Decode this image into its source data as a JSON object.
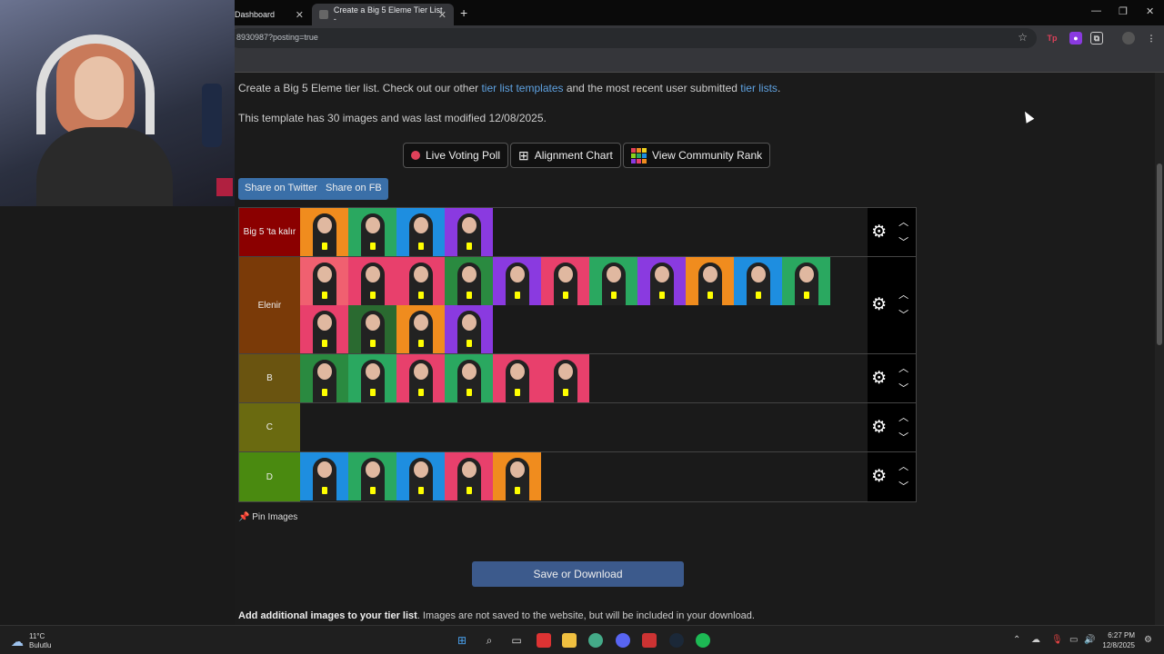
{
  "browser": {
    "tabs": [
      {
        "label": "Dashboard"
      },
      {
        "label": "Create a Big 5 Eleme Tier List -"
      }
    ],
    "url": "8930987?posting=true",
    "ext_tp": "Tp"
  },
  "page": {
    "intro_prefix": "Create a Big 5 Eleme tier list. Check out our other ",
    "intro_link1": "tier list templates",
    "intro_mid": " and the most recent user submitted ",
    "intro_link2": "tier lists",
    "intro_suffix": ".",
    "info": "This template has 30 images and was last modified 12/08/2025.",
    "buttons": {
      "live_voting": "Live Voting Poll",
      "alignment": "Alignment Chart",
      "community": "View Community Rank"
    },
    "share": {
      "twitter": "Share on Twitter",
      "fb": "Share on FB"
    },
    "tiers": [
      {
        "label": "Big 5 'ta kalır",
        "color": "#8b0000",
        "images": [
          "#f08c1e",
          "#2aa860",
          "#1e8ee0",
          "#8a3ae0"
        ]
      },
      {
        "label": "Elenir",
        "color": "#7a3a08",
        "images": [
          "#f06070",
          "#e8406c",
          "#e8406c",
          "#2a8a40",
          "#8a3ae0",
          "#e8406c",
          "#2aa860",
          "#8a3ae0",
          "#f08c1e",
          "#1e8ee0",
          "#2aa860",
          "#e8406c",
          "#2a6a30",
          "#f08c1e",
          "#8a3ae0"
        ]
      },
      {
        "label": "B",
        "color": "#6a5410",
        "images": [
          "#2a8a40",
          "#2aa860",
          "#e8406c",
          "#2aa860",
          "#e8406c",
          "#e8406c"
        ]
      },
      {
        "label": "C",
        "color": "#6a6a10",
        "images": []
      },
      {
        "label": "D",
        "color": "#4a8a10",
        "images": [
          "#1e8ee0",
          "#2aa860",
          "#1e8ee0",
          "#e8406c",
          "#f08c1e"
        ]
      }
    ],
    "pin_images": "Pin Images",
    "save": "Save or Download",
    "add_bold": "Add additional images to your tier list",
    "add_rest": ". Images are not saved to the website, but will be included in your download."
  },
  "taskbar": {
    "temp": "11°C",
    "weather": "Bulutlu",
    "time": "6:27 PM",
    "date": "12/8/2025"
  }
}
